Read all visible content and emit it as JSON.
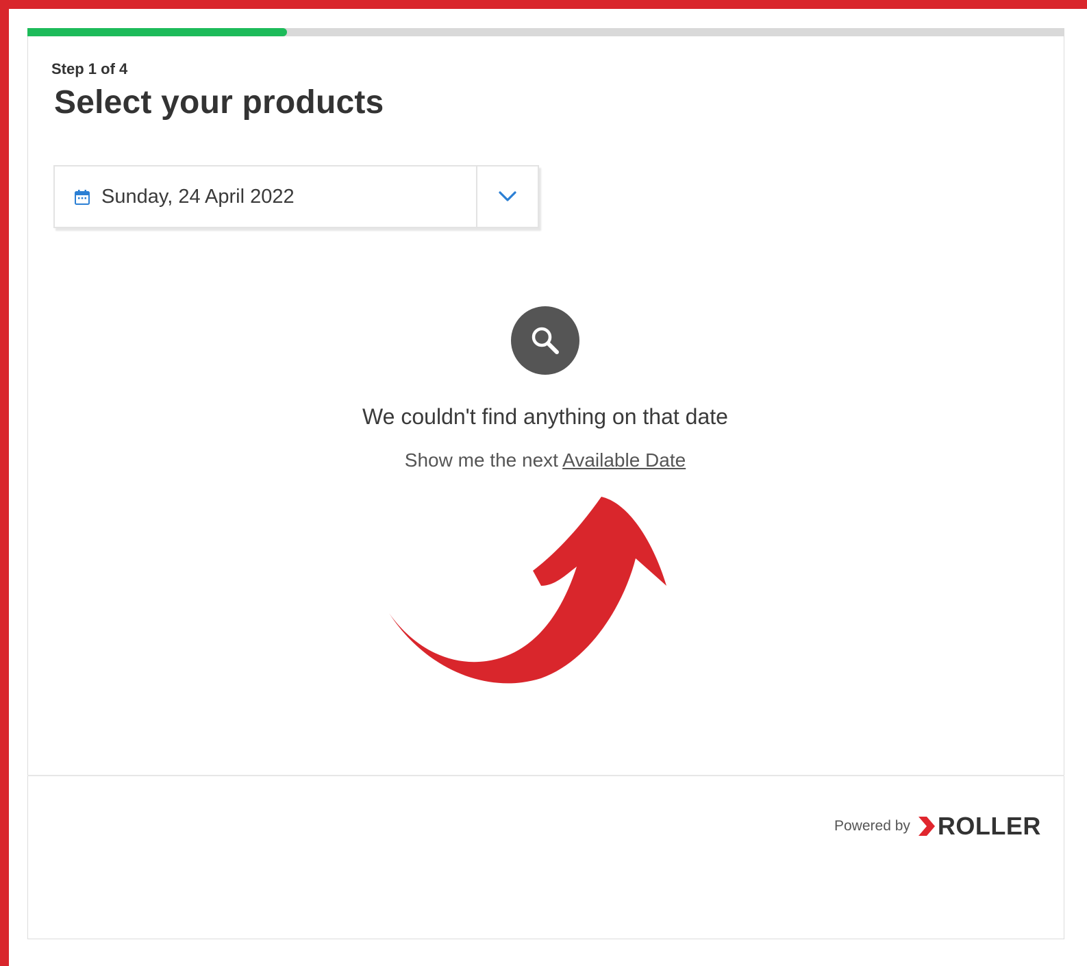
{
  "progress": {
    "fraction": 0.25,
    "color": "#1dbb5a"
  },
  "header": {
    "step_label": "Step 1 of 4",
    "title": "Select your products"
  },
  "date_picker": {
    "value": "Sunday, 24 April 2022",
    "icon": "calendar-icon",
    "toggle_icon": "chevron-down-icon"
  },
  "empty_state": {
    "icon": "search-icon",
    "message": "We couldn't find anything on that date",
    "next_prefix": "Show me the next",
    "next_link": "Available Date"
  },
  "annotation": {
    "icon": "curved-arrow-icon",
    "color": "#d9262c"
  },
  "footer": {
    "powered_by": "Powered by",
    "brand": "ROLLER",
    "brand_color": "#e0262e"
  },
  "colors": {
    "frame": "#d9262c",
    "accent_blue": "#2b7fd4"
  }
}
